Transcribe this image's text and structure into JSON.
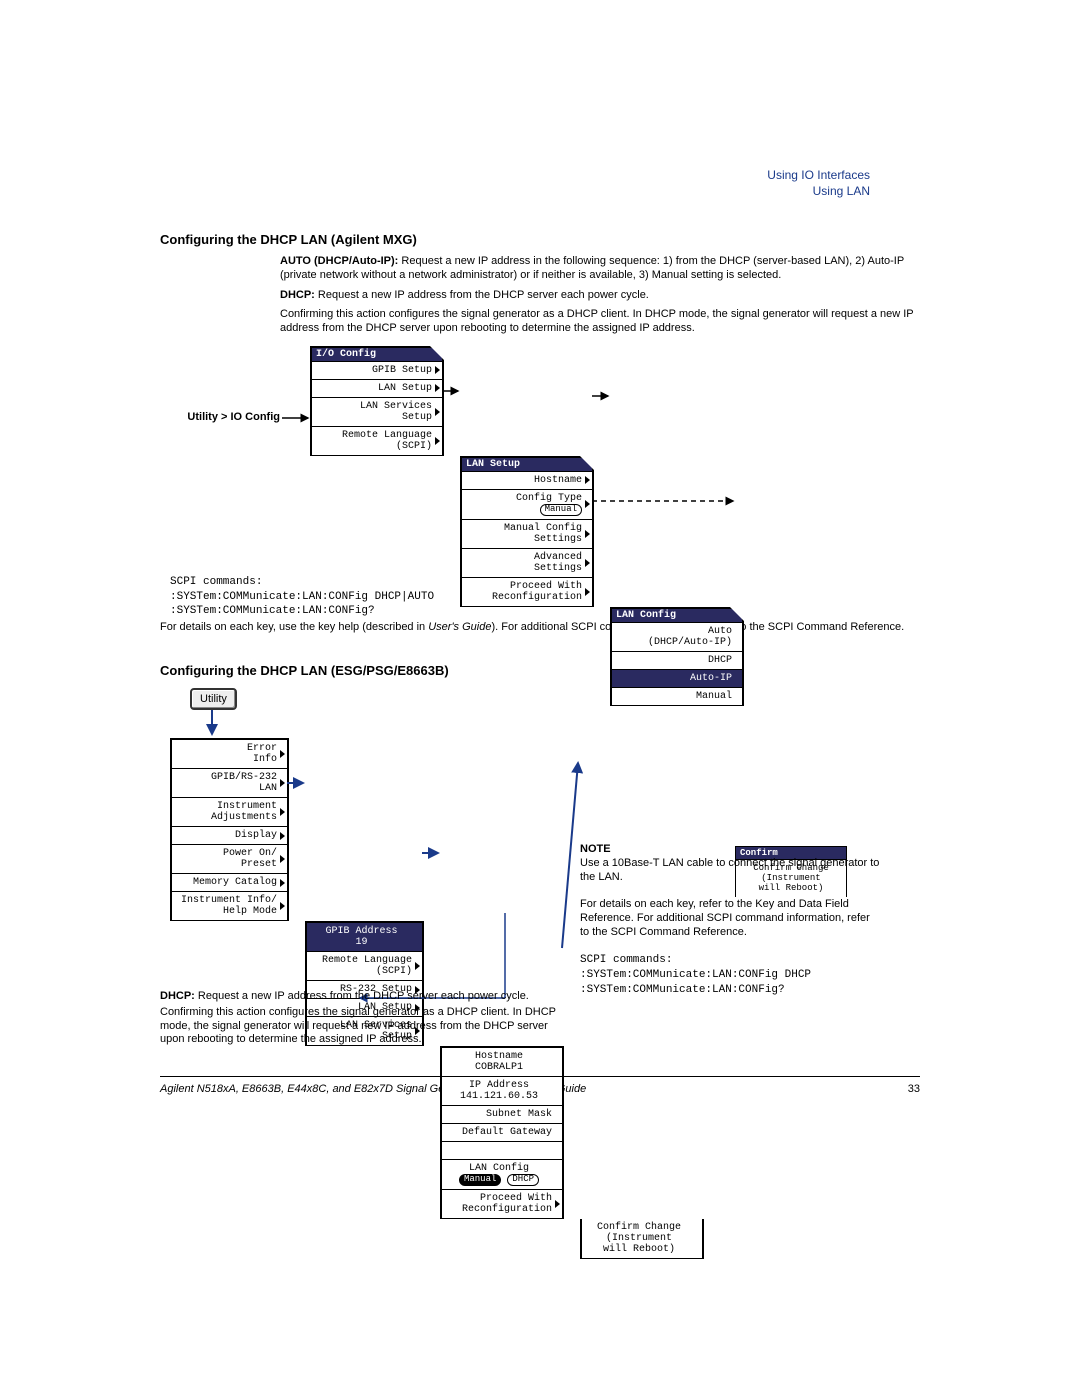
{
  "header": {
    "line1": "Using IO Interfaces",
    "line2": "Using LAN"
  },
  "section1": {
    "title": "Configuring the DHCP LAN (Agilent MXG)",
    "auto_label": "AUTO (DHCP/Auto-IP):",
    "auto_text": " Request a new IP address in the following sequence: 1) from the DHCP (server-based LAN), 2) Auto-IP (private network without a network administrator) or if neither is available, 3) Manual setting is selected.",
    "dhcp_label": "DHCP:",
    "dhcp_text": " Request a new IP address from the DHCP server each power cycle.",
    "confirm_text": "Confirming this action configures the signal generator as a DHCP client. In DHCP mode, the signal generator will request a new IP address from the DHCP server upon rebooting to determine the assigned IP address.",
    "util_label": "Utility > IO Config",
    "menus": {
      "io": {
        "title": "I/O Config",
        "items": [
          "GPIB Setup",
          "LAN Setup",
          "LAN Services\nSetup",
          "Remote Language\n(SCPI)"
        ]
      },
      "lan": {
        "title": "LAN Setup",
        "items": [
          "Hostname",
          "Config Type",
          "Manual Config\nSettings",
          "Advanced\nSettings",
          "Proceed With\nReconfiguration"
        ],
        "badge": "Manual"
      },
      "lancfg": {
        "title": "LAN Config",
        "items": [
          "Auto\n(DHCP/Auto-IP)",
          "DHCP",
          "Auto-IP",
          "Manual"
        ]
      },
      "confirm": {
        "title": "Confirm",
        "body": "Confirm Change\n(Instrument\nwill Reboot)"
      }
    },
    "scpi_head": "SCPI commands:",
    "scpi1": ":SYSTem:COMMunicate:LAN:CONFig DHCP|AUTO",
    "scpi2": ":SYSTem:COMMunicate:LAN:CONFig?",
    "followup": "For details on each key, use the key help (described in User's Guide). For additional SCPI command information, refer to the SCPI Command Reference."
  },
  "section2": {
    "title": "Configuring the DHCP LAN (ESG/PSG/E8663B)",
    "utility_btn": "Utility",
    "menu_a": {
      "items": [
        "Error\nInfo",
        "GPIB/RS-232\nLAN",
        "Instrument\nAdjustments",
        "Display",
        "Power On/\nPreset",
        "Memory Catalog",
        "Instrument Info/\nHelp Mode"
      ]
    },
    "menu_b": {
      "items": [
        "GPIB Address\n19",
        "Remote Language\n(SCPI)",
        "RS-232 Setup",
        "LAN Setup",
        "LAN Services\nSetup"
      ]
    },
    "menu_c": {
      "items": [
        "Hostname\nCOBRALP1",
        "IP Address\n141.121.60.53",
        "Subnet Mask",
        "Default Gateway",
        "LAN Config\nManual DHCP",
        "Proceed With\nReconfiguration"
      ],
      "badge_manual": "Manual",
      "badge_dhcp": "DHCP"
    },
    "menu_d": {
      "body": "Confirm Change\n(Instrument\nwill Reboot)"
    },
    "note_head": "NOTE",
    "note_body": "Use a 10Base-T LAN cable to connect the signal generator to the LAN.",
    "ref_body": "For details on each key, refer to the Key and Data Field Reference. For additional SCPI command information, refer to the SCPI Command Reference.",
    "scpi_head": "SCPI commands:",
    "scpi1": ":SYSTem:COMMunicate:LAN:CONFig DHCP",
    "scpi2": ":SYSTem:COMMunicate:LAN:CONFig?",
    "dhcp_label": "DHCP:",
    "dhcp_text": " Request a new IP address from the DHCP server each power cycle.",
    "confirm_text": "Confirming this action configures the signal generator as a DHCP client. In DHCP mode, the signal generator will request a new IP address from the DHCP server upon rebooting to determine the assigned IP address."
  },
  "footer": {
    "text": "Agilent N518xA, E8663B, E44x8C, and E82x7D Signal Generators Programming Guide",
    "page": "33"
  }
}
